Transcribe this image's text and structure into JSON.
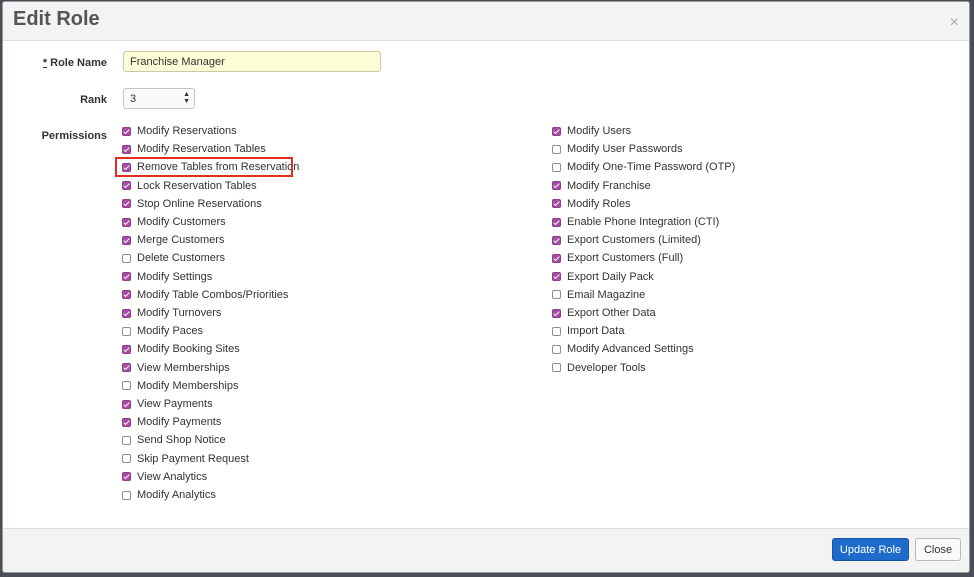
{
  "modal": {
    "title": "Edit Role",
    "close_symbol": "×"
  },
  "form": {
    "required_mark": "*",
    "role_name_label": "Role Name",
    "role_name_value": "Franchise Manager",
    "rank_label": "Rank",
    "rank_value": "3",
    "permissions_label": "Permissions"
  },
  "permissions": {
    "left": [
      {
        "label": "Modify Reservations",
        "checked": true
      },
      {
        "label": "Modify Reservation Tables",
        "checked": true
      },
      {
        "label": "Remove Tables from Reservation",
        "checked": true
      },
      {
        "label": "Lock Reservation Tables",
        "checked": true
      },
      {
        "label": "Stop Online Reservations",
        "checked": true
      },
      {
        "label": "Modify Customers",
        "checked": true
      },
      {
        "label": "Merge Customers",
        "checked": true
      },
      {
        "label": "Delete Customers",
        "checked": false
      },
      {
        "label": "Modify Settings",
        "checked": true
      },
      {
        "label": "Modify Table Combos/Priorities",
        "checked": true
      },
      {
        "label": "Modify Turnovers",
        "checked": true
      },
      {
        "label": "Modify Paces",
        "checked": false
      },
      {
        "label": "Modify Booking Sites",
        "checked": true
      },
      {
        "label": "View Memberships",
        "checked": true
      },
      {
        "label": "Modify Memberships",
        "checked": false
      },
      {
        "label": "View Payments",
        "checked": true
      },
      {
        "label": "Modify Payments",
        "checked": true
      },
      {
        "label": "Send Shop Notice",
        "checked": false
      },
      {
        "label": "Skip Payment Request",
        "checked": false
      },
      {
        "label": "View Analytics",
        "checked": true
      },
      {
        "label": "Modify Analytics",
        "checked": false
      }
    ],
    "right": [
      {
        "label": "Modify Users",
        "checked": true
      },
      {
        "label": "Modify User Passwords",
        "checked": false
      },
      {
        "label": "Modify One-Time Password (OTP)",
        "checked": false
      },
      {
        "label": "Modify Franchise",
        "checked": true
      },
      {
        "label": "Modify Roles",
        "checked": true
      },
      {
        "label": "Enable Phone Integration (CTI)",
        "checked": true
      },
      {
        "label": "Export Customers (Limited)",
        "checked": true
      },
      {
        "label": "Export Customers (Full)",
        "checked": true
      },
      {
        "label": "Export Daily Pack",
        "checked": true
      },
      {
        "label": "Email Magazine",
        "checked": false
      },
      {
        "label": "Export Other Data",
        "checked": true
      },
      {
        "label": "Import Data",
        "checked": false
      },
      {
        "label": "Modify Advanced Settings",
        "checked": false
      },
      {
        "label": "Developer Tools",
        "checked": false
      }
    ]
  },
  "footer": {
    "update_label": "Update Role",
    "close_label": "Close"
  },
  "colors": {
    "checkbox_checked": "#a74da4",
    "primary_button": "#1e6bc9",
    "highlight_box": "#e32d1f",
    "input_highlight": "#fcfcd6"
  }
}
